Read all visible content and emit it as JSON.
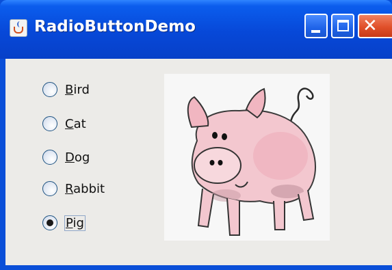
{
  "window": {
    "title": "RadioButtonDemo",
    "app_icon": "java-cup-icon",
    "controls": {
      "minimize_icon": "minimize-icon",
      "maximize_icon": "maximize-icon",
      "close_icon": "close-icon",
      "close_glyph": "✕"
    }
  },
  "radio_group": {
    "options": [
      {
        "label_mnemonic": "B",
        "label_rest": "ird",
        "selected": false
      },
      {
        "label_mnemonic": "C",
        "label_rest": "at",
        "selected": false
      },
      {
        "label_mnemonic": "D",
        "label_rest": "og",
        "selected": false
      },
      {
        "label_mnemonic": "R",
        "label_rest": "abbit",
        "selected": false
      },
      {
        "label_mnemonic": "P",
        "label_rest": "ig",
        "selected": true
      }
    ],
    "selected_label": "Pig"
  },
  "image": {
    "subject": "pig-illustration"
  },
  "colors": {
    "titlebar": "#0748d8",
    "client_background": "#ecebe8",
    "close_button": "#e0502a"
  }
}
